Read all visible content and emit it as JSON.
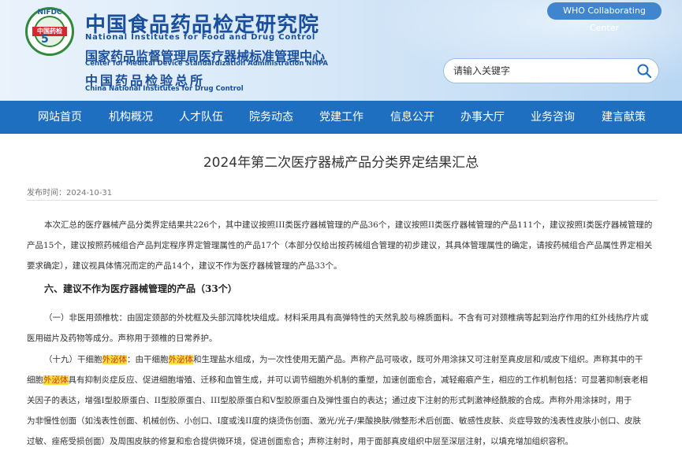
{
  "header": {
    "logo_text_top": "NIFDC",
    "logo_text_band": "中国药检",
    "logo_numeral": "5",
    "org1_cn": "中国食品药品检定研究院",
    "org1_en": "National Institutes for Food and Drug Control",
    "org2_cn": "国家药品监督管理局医疗器械标准管理中心",
    "org2_en": "Center for Medical Device Standardization Administration NMPA",
    "org3_cn": "中国药品检验总所",
    "org3_en": "China National Institutes for Drug Control",
    "who_label": "WHO Collaborating Center",
    "search_placeholder": "请输入关键字"
  },
  "nav": {
    "items": [
      "网站首页",
      "机构概况",
      "人才队伍",
      "院务动态",
      "党建工作",
      "信息公开",
      "办事大厅",
      "业务咨询",
      "建言献策"
    ]
  },
  "article": {
    "title": "2024年第二次医疗器械产品分类界定结果汇总",
    "date": "发布时间：2024-10-31",
    "intro_line1": "本次汇总的医疗器械产品分类界定结果共226个，其中建议按照III类医疗器械管理的产品36个，建议按照II类医疗器械管理的产品111个，建议按照I类医疗器械管理的",
    "intro_line2": "产品15个，建议按照药械组合产品判定程序界定管理属性的产品17个（本部分仅给出按药械组合管理的初步建议，其具体管理属性的确定，请按药械组合产品属性界定相关",
    "intro_line3": "要求确定），建议视具体情况而定的产品14个，建议不作为医疗器械管理的产品33个。",
    "section_heading": "六、建议不作为医疗器械管理的产品（33个）",
    "item1_line1": "（一）非医用颈椎枕：由固定颈部的外枕框及头部沉降枕块组成。材料采用具有高弹特性的天然乳胶与棉质面料。不含有可对颈椎病等起到治疗作用的红外线热疗片或",
    "item1_line2": "医用磁片及药物等成分。声称用于颈椎的日常养护。",
    "item19_a": "（十九）干细胞",
    "item19_hl1": "外泌体",
    "item19_b": "：由干细胞",
    "item19_hl2": "外泌体",
    "item19_c": "和生理盐水组成，为一次性使用无菌产品。声称产品可吸收，既可外用涂抹又可注射至真皮层和/或皮下组织。声称其中的干",
    "item19_d": "细胞",
    "item19_hl3": "外泌体",
    "item19_e": "具有抑制炎症反应、促进细胞增殖、迁移和血管生成，并可以调节细胞外机制的重塑，加速创面愈合，减轻瘢痕产生，相应的工作机制包括：可显著抑制衰老相",
    "item19_line3": "关因子的表达，增强I型胶原蛋白、II型胶原蛋白、III型胶原蛋白和V型胶原蛋白及弹性蛋白的表达；通过皮下注射的形式刺激神经酰胺的合成。声称外用涂抹时，用于",
    "item19_line4": "为非慢性创面（如浅表性创面、机械创伤、小创口、I度或浅II度的烧烫伤创面、激光/光子/果酸换肤/微整形术后创面、敏感性皮肤、炎症导致的浅表性皮肤小创口、皮肤",
    "item19_line5": "过敏、痤疮受损创面）及周围皮肤的修复和愈合提供微环境，促进创面愈合；声称注射时，用于面部真皮组织中层至深层注射，以填充增加组织容积。"
  },
  "colors": {
    "nav_bg": "#1f6fc0",
    "title_blue": "#1a4f9c",
    "highlight_bg": "#f7e03a",
    "highlight_text": "#d6312b"
  },
  "icons": [
    "search-icon"
  ]
}
